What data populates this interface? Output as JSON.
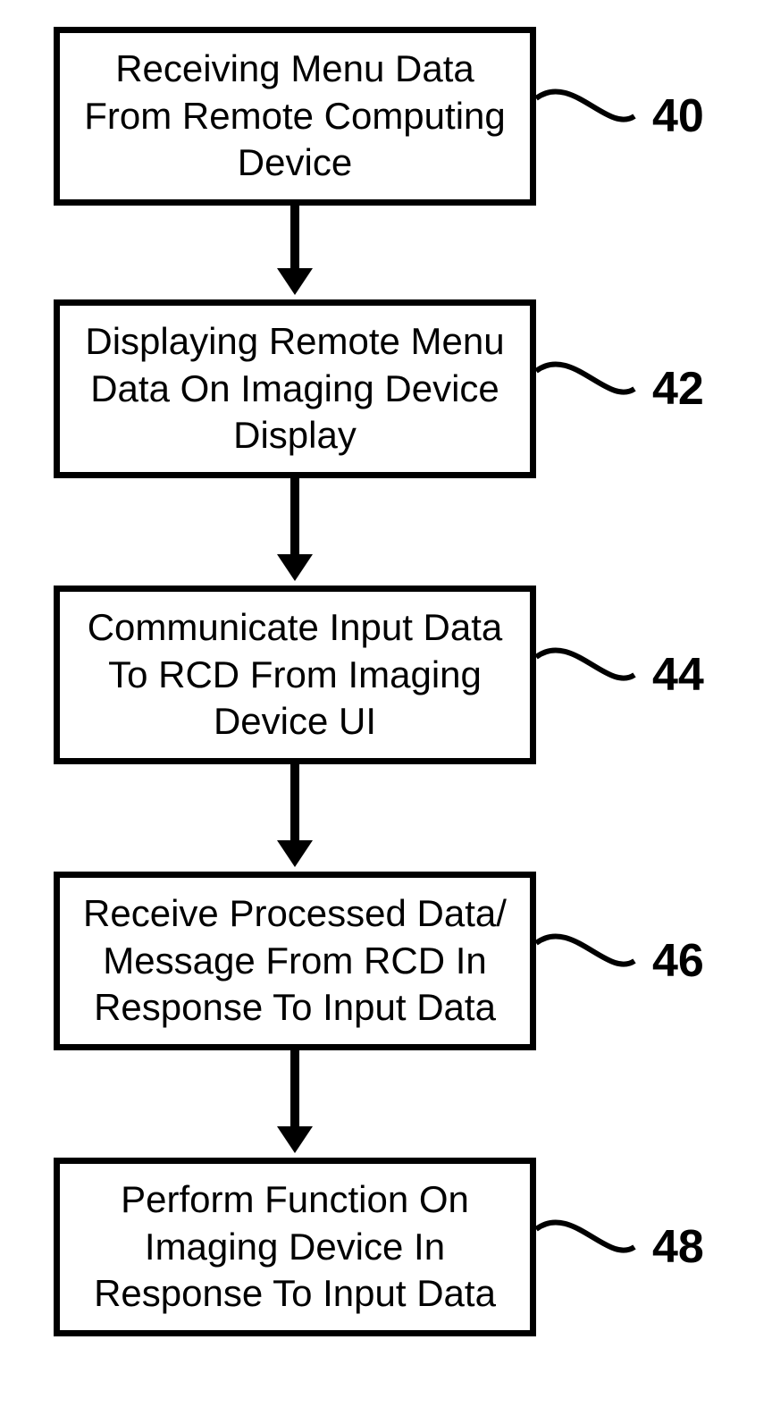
{
  "chart_data": {
    "type": "flowchart",
    "direction": "top-to-bottom",
    "nodes": [
      {
        "id": "40",
        "label": "Receiving Menu Data From Remote Computing Device"
      },
      {
        "id": "42",
        "label": "Displaying Remote Menu Data On Imaging Device Display"
      },
      {
        "id": "44",
        "label": "Communicate Input Data To RCD From Imaging Device UI"
      },
      {
        "id": "46",
        "label": "Receive Processed Data/ Message From RCD In Response To Input Data"
      },
      {
        "id": "48",
        "label": "Perform Function On Imaging Device In Response To Input Data"
      }
    ],
    "edges": [
      {
        "from": "40",
        "to": "42"
      },
      {
        "from": "42",
        "to": "44"
      },
      {
        "from": "44",
        "to": "46"
      },
      {
        "from": "46",
        "to": "48"
      }
    ]
  },
  "steps": {
    "s40": {
      "text": "Receiving Menu Data From Remote Computing Device",
      "num": "40"
    },
    "s42": {
      "text": "Displaying Remote Menu Data On Imaging Device Display",
      "num": "42"
    },
    "s44": {
      "text": "Communicate Input Data To RCD From Imaging Device UI",
      "num": "44"
    },
    "s46": {
      "text": "Receive Processed Data/ Message From RCD In Response To Input Data",
      "num": "46"
    },
    "s48": {
      "text": "Perform Function On Imaging Device In Response To Input Data",
      "num": "48"
    }
  }
}
